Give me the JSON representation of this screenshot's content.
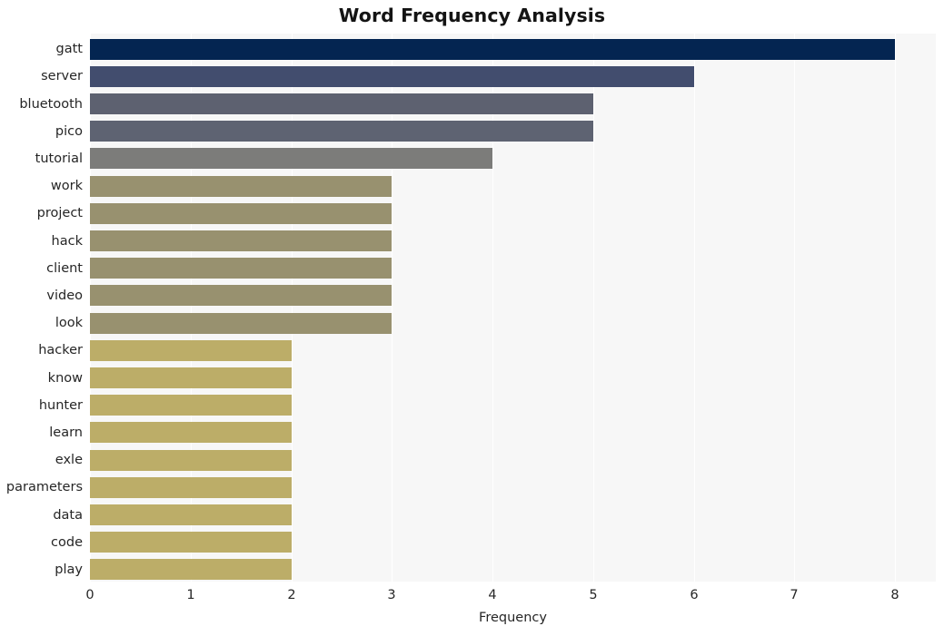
{
  "chart_data": {
    "type": "bar",
    "orientation": "horizontal",
    "title": "Word Frequency Analysis",
    "xlabel": "Frequency",
    "ylabel": "",
    "xlim": [
      0,
      8
    ],
    "xticks": [
      "0",
      "1",
      "2",
      "3",
      "4",
      "5",
      "6",
      "7",
      "8"
    ],
    "grid": true,
    "legend": null,
    "categories": [
      "gatt",
      "server",
      "bluetooth",
      "pico",
      "tutorial",
      "work",
      "project",
      "hack",
      "client",
      "video",
      "look",
      "hacker",
      "know",
      "hunter",
      "learn",
      "exle",
      "parameters",
      "data",
      "code",
      "play"
    ],
    "values": [
      8,
      6,
      5,
      5,
      4,
      3,
      3,
      3,
      3,
      3,
      3,
      2,
      2,
      2,
      2,
      2,
      2,
      2,
      2,
      2
    ],
    "bar_colors": [
      "#042551",
      "#424d6e",
      "#5d6170",
      "#5e6372",
      "#7c7c7a",
      "#98916f",
      "#98916f",
      "#98916f",
      "#98916f",
      "#98916f",
      "#98916f",
      "#bcad68",
      "#bcad68",
      "#bcad68",
      "#bcad68",
      "#bcad68",
      "#bcad68",
      "#bcad68",
      "#bcad68",
      "#bcad68"
    ],
    "plot_background": "#f7f7f7",
    "figure_background": "#ffffff",
    "gridline_color": "#ffffff",
    "text_color": "#262626",
    "title_color": "#141414"
  }
}
